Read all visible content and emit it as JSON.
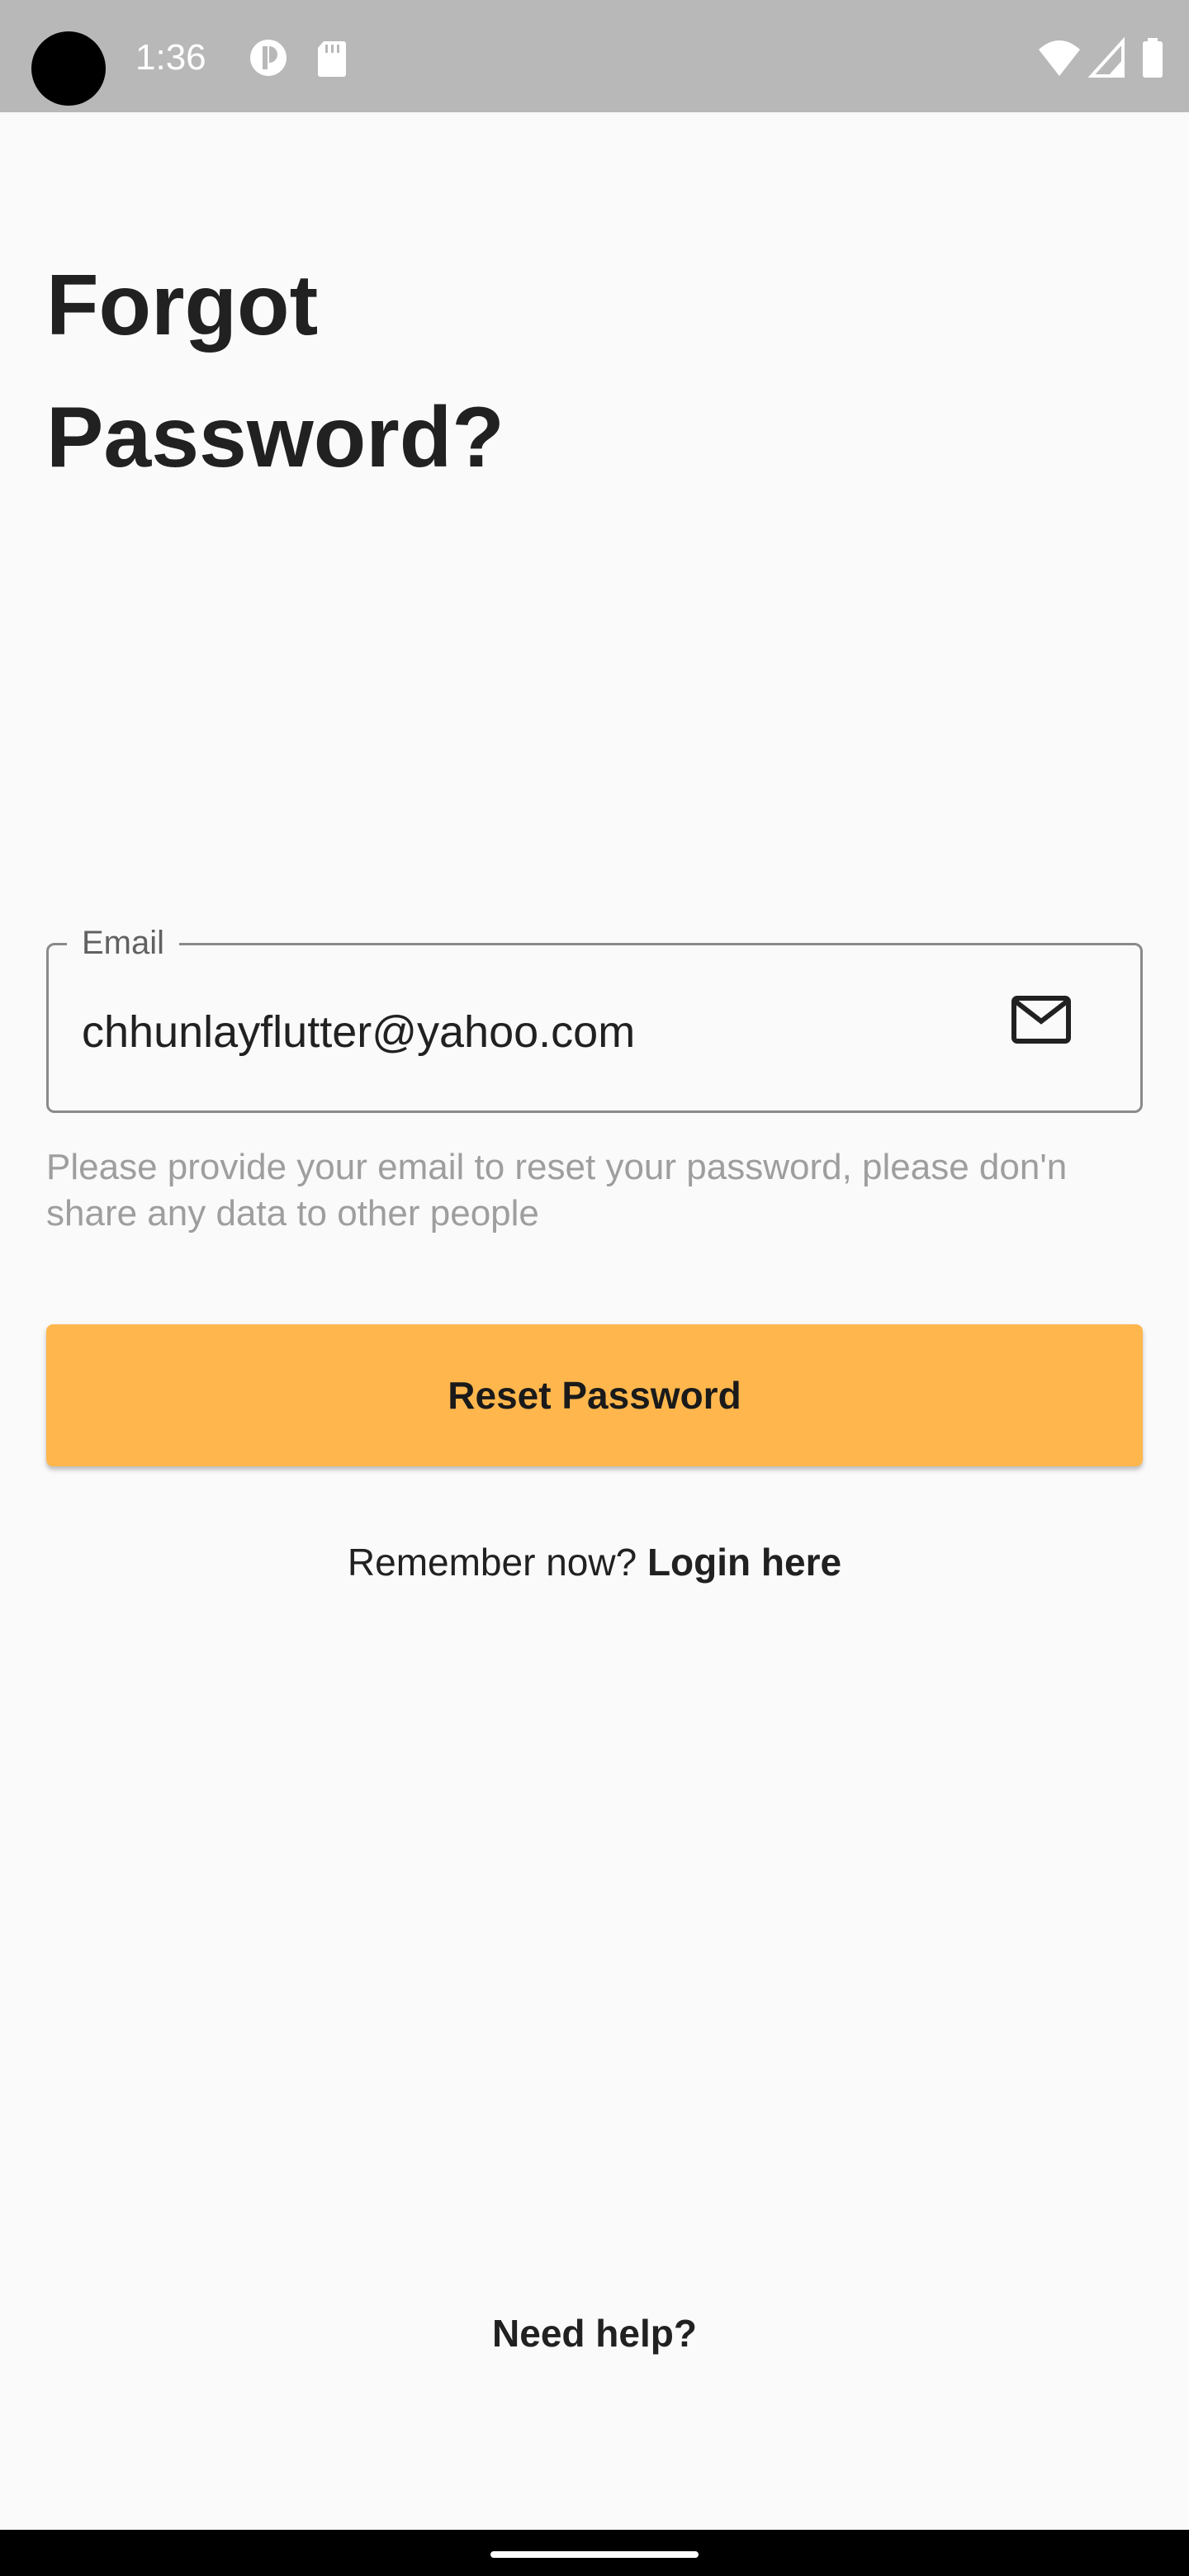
{
  "status_bar": {
    "time": "1:36",
    "icons": [
      "camera-cutout",
      "app-notification-icon",
      "sd-card-icon",
      "wifi-icon",
      "cellular-signal-icon",
      "battery-icon"
    ]
  },
  "page": {
    "title": "Forgot Password?"
  },
  "email_field": {
    "label": "Email",
    "value": "chhunlayflutter@yahoo.com",
    "icon": "mail-icon"
  },
  "helper_text": "Please provide your email to reset your password, please don'n share any data to other people",
  "reset_button": {
    "label": "Reset Password",
    "color": "#ffb74d"
  },
  "remember": {
    "prompt": "Remember now?",
    "link": "Login here"
  },
  "footer": {
    "help_label": "Need help?"
  }
}
